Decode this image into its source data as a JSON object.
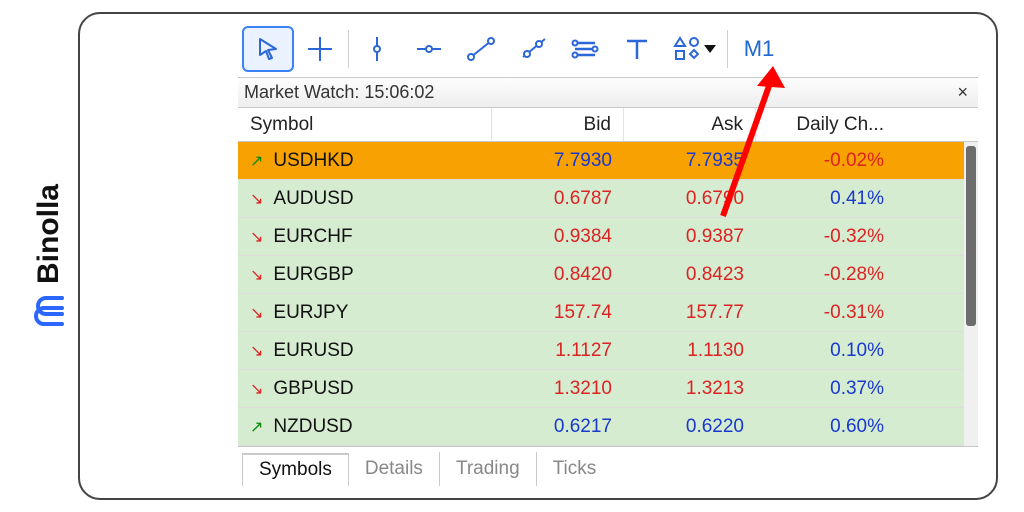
{
  "brand": {
    "name": "Binolla"
  },
  "toolbar": {
    "cursor": "cursor",
    "crosshair": "crosshair",
    "vline": "vertical-line",
    "hline": "horizontal-line",
    "trend": "trend-line",
    "angle": "angle-trend",
    "equidistant": "equidistant-channel",
    "text": "text",
    "shapes": "shapes",
    "timeframe": "M1"
  },
  "panel": {
    "title": "Market Watch: 15:06:02",
    "close": "×"
  },
  "columns": {
    "symbol": "Symbol",
    "bid": "Bid",
    "ask": "Ask",
    "change": "Daily Ch..."
  },
  "rows": [
    {
      "dir": "up",
      "symbol": "USDHKD",
      "bid": "7.7930",
      "ask": "7.7935",
      "change": "-0.02%",
      "bgColor": "orange",
      "bidColor": "blue",
      "askColor": "blue",
      "changeColor": "red",
      "symColor": "black"
    },
    {
      "dir": "down",
      "symbol": "AUDUSD",
      "bid": "0.6787",
      "ask": "0.6790",
      "change": "0.41%",
      "bgColor": "green",
      "bidColor": "red",
      "askColor": "red",
      "changeColor": "blue",
      "symColor": "black"
    },
    {
      "dir": "down",
      "symbol": "EURCHF",
      "bid": "0.9384",
      "ask": "0.9387",
      "change": "-0.32%",
      "bgColor": "green",
      "bidColor": "red",
      "askColor": "red",
      "changeColor": "red",
      "symColor": "black"
    },
    {
      "dir": "down",
      "symbol": "EURGBP",
      "bid": "0.8420",
      "ask": "0.8423",
      "change": "-0.28%",
      "bgColor": "green",
      "bidColor": "red",
      "askColor": "red",
      "changeColor": "red",
      "symColor": "black"
    },
    {
      "dir": "down",
      "symbol": "EURJPY",
      "bid": "157.74",
      "ask": "157.77",
      "change": "-0.31%",
      "bgColor": "green",
      "bidColor": "red",
      "askColor": "red",
      "changeColor": "red",
      "symColor": "black"
    },
    {
      "dir": "down",
      "symbol": "EURUSD",
      "bid": "1.1127",
      "ask": "1.1130",
      "change": "0.10%",
      "bgColor": "green",
      "bidColor": "red",
      "askColor": "red",
      "changeColor": "blue",
      "symColor": "black"
    },
    {
      "dir": "down",
      "symbol": "GBPUSD",
      "bid": "1.3210",
      "ask": "1.3213",
      "change": "0.37%",
      "bgColor": "green",
      "bidColor": "red",
      "askColor": "red",
      "changeColor": "blue",
      "symColor": "black"
    },
    {
      "dir": "up",
      "symbol": "NZDUSD",
      "bid": "0.6217",
      "ask": "0.6220",
      "change": "0.60%",
      "bgColor": "green",
      "bidColor": "blue",
      "askColor": "blue",
      "changeColor": "blue",
      "symColor": "black"
    }
  ],
  "tabs": {
    "symbols": "Symbols",
    "details": "Details",
    "trading": "Trading",
    "ticks": "Ticks"
  }
}
